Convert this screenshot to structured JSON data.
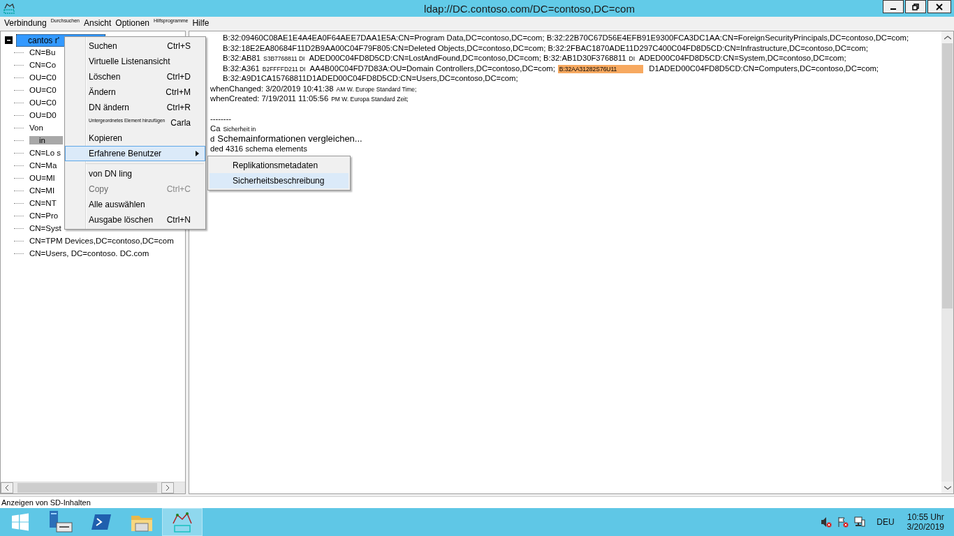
{
  "window": {
    "title": "ldap://DC.contoso.com/DC=contoso,DC=com"
  },
  "menu_bar": [
    {
      "label": "Verbindung",
      "kind": "normal"
    },
    {
      "label": "Durchsuchen",
      "kind": "small"
    },
    {
      "label": "Ansicht",
      "kind": "normal"
    },
    {
      "label": "Optionen",
      "kind": "normal"
    },
    {
      "label": "Hilfsprogramme",
      "kind": "small"
    },
    {
      "label": "Hilfe",
      "kind": "normal"
    }
  ],
  "tree": {
    "root": {
      "label": "cantos r'",
      "selected": true,
      "expanded": true
    },
    "children": [
      {
        "label": "CN=Bu",
        "marked": false
      },
      {
        "label": "CN=Co",
        "marked": false
      },
      {
        "label": "OU=C0",
        "marked": false
      },
      {
        "label": "OU=C0",
        "marked": false
      },
      {
        "label": "OU=C0",
        "marked": false
      },
      {
        "label": "OU=D0",
        "marked": false
      },
      {
        "label": "Von",
        "marked": false
      },
      {
        "label": "in",
        "marked": true
      },
      {
        "label": "CN=Lo s",
        "marked": false
      },
      {
        "label": "CN=Ma",
        "marked": false
      },
      {
        "label": "OU=MI",
        "marked": false
      },
      {
        "label": "CN=MI",
        "marked": false
      },
      {
        "label": "CN=NT",
        "marked": false
      },
      {
        "label": "CN=Pro",
        "marked": false
      },
      {
        "label": "CN=Syst",
        "marked": false
      },
      {
        "label": "CN=TPM Devices,DC=contoso,DC=com",
        "marked": false
      },
      {
        "label": "CN=Users, DC=contoso. DC.com",
        "marked": false
      }
    ]
  },
  "output": {
    "values": [
      [
        {
          "text": "B:32:09460C08AE1E4A4EA0F64AEE7DAA1E5A:CN=Program Data,DC=contoso,DC=com; B:32:22B70C67D56E4EFB91E9300FCA3DC1AA:CN=ForeignSecurityPrincipals,DC=contoso,DC=com;",
          "kind": "normal"
        }
      ],
      [
        {
          "text": "B:32:18E2EA80684F11D2B9AA00C04F79F805:CN=Deleted Objects,DC=contoso,DC=com; B:32:2FBAC1870ADE11D297C400C04FD8D5CD:CN=Infrastructure,DC=contoso,DC=com;",
          "kind": "normal"
        }
      ],
      [
        {
          "text": "B:32:AB81",
          "kind": "normal"
        },
        {
          "text": "S3B7768811 DI",
          "kind": "small"
        },
        {
          "text": "ADED00C04FD8D5CD:CN=LostAndFound,DC=contoso,DC=com; B:32:AB1D30F3768811",
          "kind": "normal"
        },
        {
          "text": "DI",
          "kind": "small"
        },
        {
          "text": "ADED00C04FD8D5CD:CN=System,DC=contoso,DC=com;",
          "kind": "normal"
        }
      ],
      [
        {
          "text": "B:32:A361",
          "kind": "normal"
        },
        {
          "text": "B2FFFFD211 DI",
          "kind": "small"
        },
        {
          "text": "AA4B00C04FD7D83A:OU=Domain Controllers,DC=contoso,DC=com;",
          "kind": "normal"
        },
        {
          "text": "B:32AA31282S76U11",
          "kind": "highlight"
        },
        {
          "text": "D1ADED00C04FD8D5CD:CN=Computers,DC=contoso,DC=com;",
          "kind": "normal"
        }
      ],
      [
        {
          "text": "B:32:A9D1CA15768811D1ADED00C04FD8D5CD:CN=Users,DC=contoso,DC=com;",
          "kind": "normal"
        }
      ]
    ],
    "timestamps": [
      [
        {
          "text": "whenChanged: 3/20/2019 10:41:38",
          "kind": "normal"
        },
        {
          "text": "AM W. Europe Standard Time;",
          "kind": "small"
        }
      ],
      [
        {
          "text": "whenCreated: 7/19/2011 11:05:56",
          "kind": "normal"
        },
        {
          "text": "PM W. Europa Standard Zeit;",
          "kind": "small"
        }
      ]
    ],
    "log": [
      [
        {
          "text": "--------",
          "kind": "normal"
        }
      ],
      [
        {
          "text": "Ca",
          "kind": "normal"
        },
        {
          "text": "Sicherheit in",
          "kind": "small"
        }
      ],
      [
        {
          "text": "d",
          "kind": "normal"
        },
        {
          "text": "Schemainformationen vergleichen...",
          "kind": "large"
        }
      ],
      [
        {
          "text": "ded 4316 schema elements",
          "kind": "normal"
        }
      ]
    ]
  },
  "context_menu": [
    {
      "label": "Suchen",
      "shortcut": "Ctrl+S",
      "kind": "item",
      "selected": false,
      "disabled": false
    },
    {
      "label": "Virtuelle Listenansicht",
      "kind": "item",
      "selected": false,
      "disabled": false
    },
    {
      "label": "Löschen",
      "shortcut": "Ctrl+D",
      "kind": "item",
      "selected": false,
      "disabled": false
    },
    {
      "label": "Ändern",
      "shortcut": "Ctrl+M",
      "kind": "item",
      "selected": false,
      "disabled": false
    },
    {
      "label": "DN ändern",
      "shortcut": "Ctrl+R",
      "kind": "item",
      "selected": false,
      "disabled": false
    },
    {
      "label": "Untergeordnetes Element hinzufügen",
      "shortcut": "Carla",
      "kind": "small",
      "selected": false,
      "disabled": false
    },
    {
      "label": "Kopieren",
      "kind": "item",
      "selected": false,
      "disabled": false
    },
    {
      "label": "Erfahrene Benutzer",
      "kind": "submenu",
      "selected": true,
      "disabled": false
    },
    {
      "kind": "separator"
    },
    {
      "label": "von DN ling",
      "kind": "item",
      "selected": false,
      "disabled": false
    },
    {
      "label": "Copy",
      "shortcut": "Ctrl+C",
      "kind": "item",
      "selected": false,
      "disabled": true
    },
    {
      "label": "Alle auswählen",
      "kind": "item",
      "selected": false,
      "disabled": false
    },
    {
      "label": "Ausgabe löschen",
      "shortcut": "Ctrl+N",
      "kind": "item",
      "selected": false,
      "disabled": false
    }
  ],
  "submenu": [
    {
      "label": "Replikationsmetadaten",
      "selected": false
    },
    {
      "label": "Sicherheitsbeschreibung",
      "selected": true
    }
  ],
  "status_bar": {
    "text": "Anzeigen von SD-Inhalten"
  },
  "taskbar": {
    "apps": [
      {
        "kind": "server",
        "active": false
      },
      {
        "kind": "shell",
        "active": false
      },
      {
        "kind": "folder",
        "active": false
      },
      {
        "kind": "ldp",
        "active": true
      }
    ],
    "language": "DEU",
    "time": "10:55 Uhr",
    "date": "3/20/2019"
  }
}
